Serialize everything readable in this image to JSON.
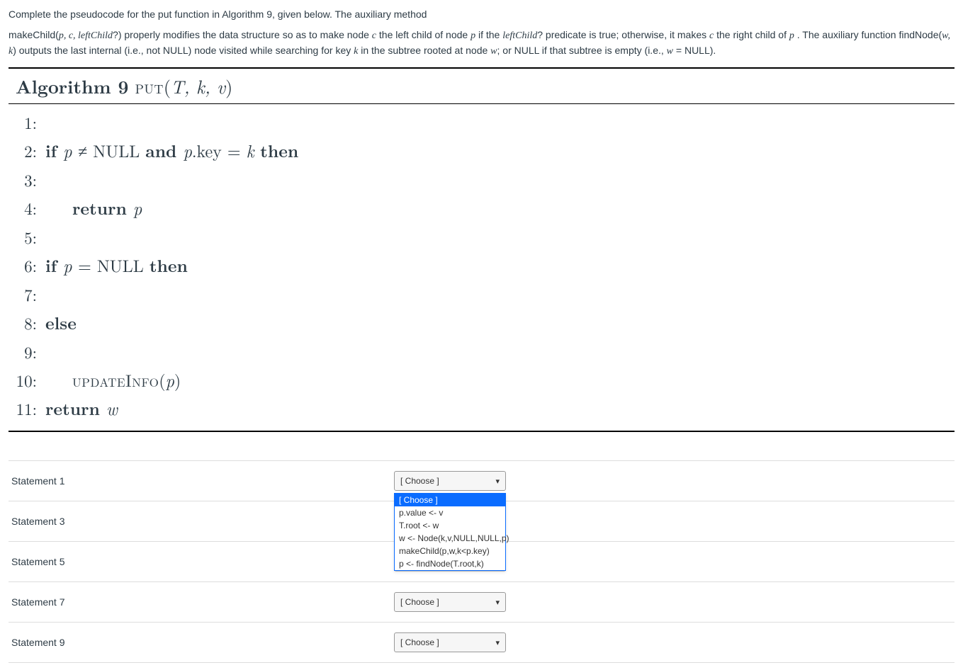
{
  "question": {
    "intro": "Complete the pseudocode for the put function in Algorithm 9, given below. The auxiliary method",
    "para2_a": "makeChild(",
    "para2_vars1": "p, c, leftChild",
    "para2_b": "?) properly modifies the data structure so as to make node ",
    "para2_c_var": "c",
    "para2_c": "  the left child of node ",
    "para2_p1": "p",
    "para2_d": "  if the ",
    "para2_lc": "leftChild",
    "para2_e": "? predicate is true; otherwise, it makes ",
    "para2_c2": "c",
    "para2_f": "  the right child of ",
    "para2_p2": "p",
    "para2_g": " . The auxiliary function findNode(",
    "para2_wk": "w, k",
    "para2_h": ") outputs the last internal (i.e., not NULL) node visited while searching for key ",
    "para2_k": "k",
    "para2_i": " in the subtree rooted at node ",
    "para2_w": "w",
    "para2_j": "; or NULL if that subtree is empty (i.e., ",
    "para2_w2": "w",
    "para2_k2": " = NULL)."
  },
  "algorithm": {
    "title_bold": "Algorithm 9",
    "title_sc": " put",
    "title_args_open": "(",
    "title_args": "T, k, v",
    "title_args_close": ")",
    "lines": {
      "n1": "1:",
      "n2": "2:",
      "n3": "3:",
      "n4": "4:",
      "n5": "5:",
      "n6": "6:",
      "n7": "7:",
      "n8": "8:",
      "n9": "9:",
      "n10": "10:",
      "n11": "11:"
    },
    "l2_if": "if ",
    "l2_p": " p ",
    "l2_ne": "≠",
    "l2_null": " NULL ",
    "l2_and": "and ",
    "l2_p2": "  p",
    "l2_key": ".key ",
    "l2_eq": "= ",
    "l2_k": "k ",
    "l2_then": "then",
    "l4_return": "return ",
    "l4_p": "p",
    "l6_if": "if ",
    "l6_p": " p ",
    "l6_eq": "= ",
    "l6_null": "NULL ",
    "l6_then": "then",
    "l8_else": "else",
    "l10_ui": "updateInfo",
    "l10_open": "(",
    "l10_p": "p",
    "l10_close": ")",
    "l11_return": "return ",
    "l11_w": "w"
  },
  "statements": {
    "s1": "Statement 1",
    "s3": "Statement 3",
    "s5": "Statement 5",
    "s7": "Statement 7",
    "s9": "Statement 9"
  },
  "select": {
    "placeholder": "[ Choose ]"
  },
  "dropdown_options": {
    "o0": "[ Choose ]",
    "o1": "p.value <- v",
    "o2": "T.root <- w",
    "o3": "w <- Node(k,v,NULL,NULL,p)",
    "o4": "makeChild(p,w,k<p.key)",
    "o5": "p <- findNode(T.root,k)"
  }
}
